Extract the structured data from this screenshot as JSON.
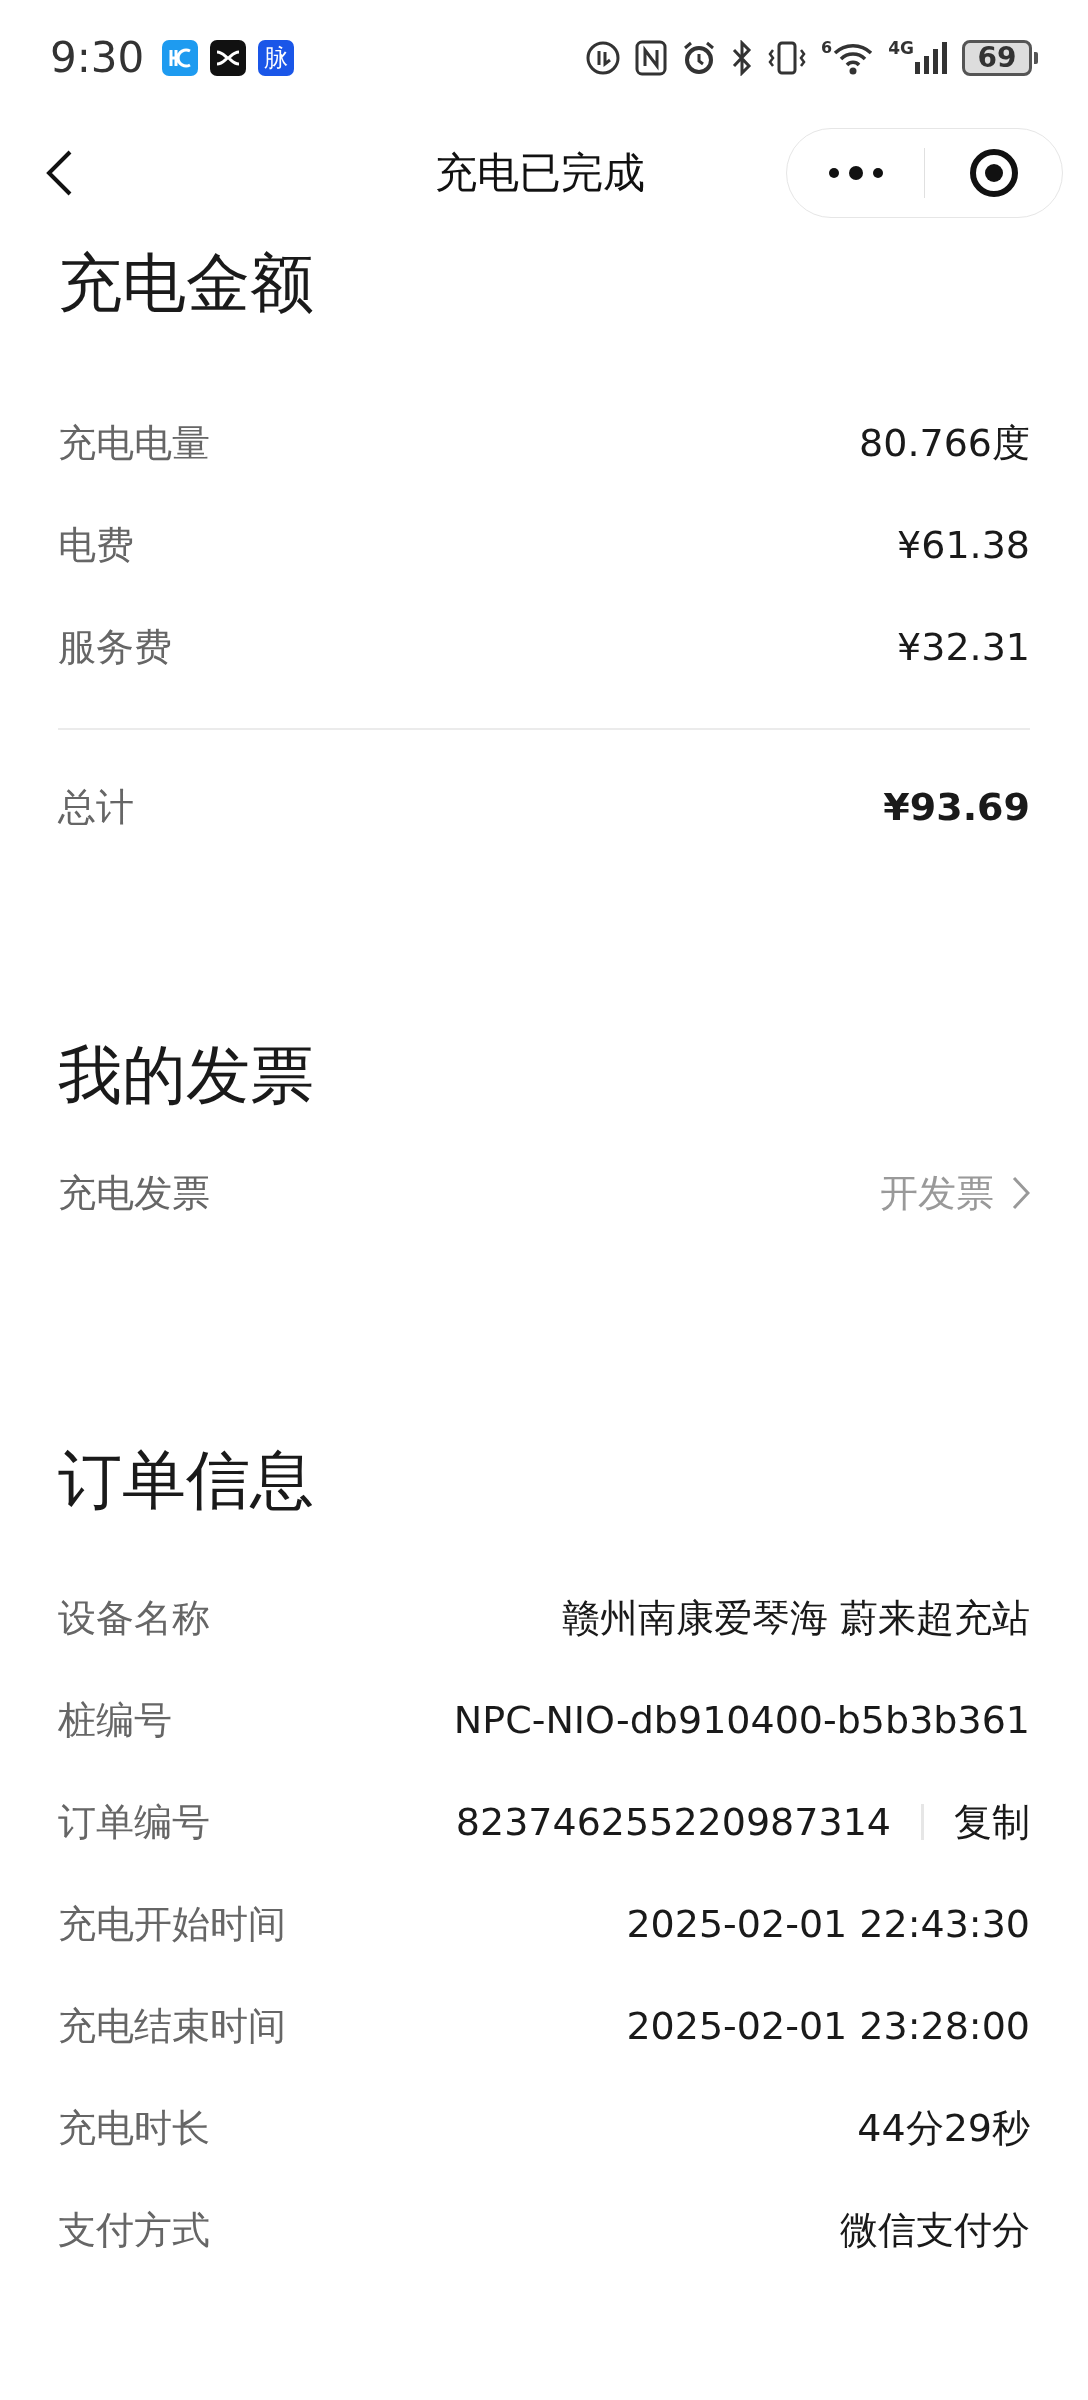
{
  "status_bar": {
    "time": "9:30",
    "app_icons": [
      {
        "kind": "hc"
      },
      {
        "kind": "x"
      },
      {
        "kind": "text",
        "label": "脉"
      }
    ],
    "wifi_badge": "6",
    "network": "4G",
    "battery": "69"
  },
  "nav": {
    "title": "充电已完成"
  },
  "amount": {
    "title": "充电金额",
    "rows": [
      {
        "label": "充电电量",
        "value": "80.766度"
      },
      {
        "label": "电费",
        "value": "¥61.38"
      },
      {
        "label": "服务费",
        "value": "¥32.31"
      }
    ],
    "total": {
      "label": "总计",
      "value": "¥93.69"
    }
  },
  "invoice": {
    "title": "我的发票",
    "label": "充电发票",
    "action": "开发票"
  },
  "order": {
    "title": "订单信息",
    "rows": [
      {
        "label": "设备名称",
        "value": "赣州南康爱琴海 蔚来超充站"
      },
      {
        "label": "桩编号",
        "value": "NPC-NIO-db910400-b5b3b361"
      },
      {
        "label": "订单编号",
        "value": "823746255220987314",
        "action": "复制"
      },
      {
        "label": "充电开始时间",
        "value": "2025-02-01 22:43:30"
      },
      {
        "label": "充电结束时间",
        "value": "2025-02-01 23:28:00"
      },
      {
        "label": "充电时长",
        "value": "44分29秒"
      },
      {
        "label": "支付方式",
        "value": "微信支付分"
      }
    ]
  }
}
